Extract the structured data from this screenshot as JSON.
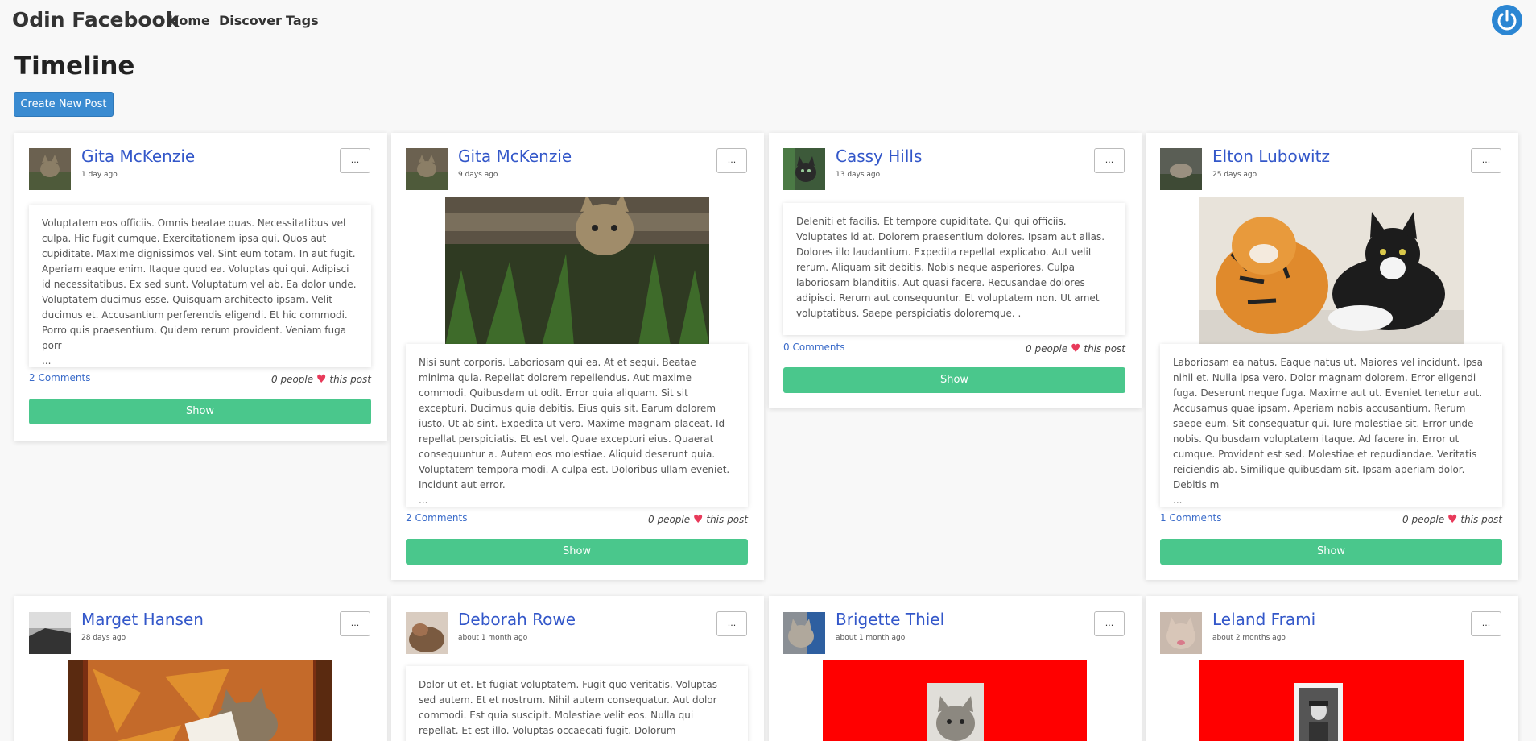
{
  "nav": {
    "brand": "Odin Facebook",
    "links": [
      "Home",
      "Discover",
      "Tags"
    ],
    "power_icon_color": "#2b86d3"
  },
  "page": {
    "title": "Timeline",
    "create_button": "Create New Post"
  },
  "posts": [
    {
      "author": "Gita McKenzie",
      "time": "1 day ago",
      "menu": "...",
      "body": "Voluptatem eos officiis. Omnis beatae quas. Necessitatibus vel culpa. Hic fugit cumque. Exercitationem ipsa qui. Quos aut cupiditate. Maxime dignissimos vel. Sint eum totam. In aut fugit. Aperiam eaque enim. Itaque quod ea. Voluptas qui qui. Adipisci id necessitatibus. Ex sed sunt. Voluptatum vel ab. Ea dolor unde. Voluptatem ducimus esse. Quisquam architecto ipsam. Velit ducimus et. Accusantium perferendis eligendi. Et hic commodi. Porro quis praesentium. Quidem rerum provident. Veniam fuga porr",
      "ellipsis": "...",
      "comments": "2 Comments",
      "likes_prefix": "0 people",
      "likes_suffix": "this post",
      "show": "Show"
    },
    {
      "author": "Gita McKenzie",
      "time": "9 days ago",
      "menu": "...",
      "body": "Nisi sunt corporis. Laboriosam qui ea. At et sequi. Beatae minima quia. Repellat dolorem repellendus. Aut maxime commodi. Quibusdam ut odit. Error quia aliquam. Sit sit excepturi. Ducimus quia debitis. Eius quis sit. Earum dolorem iusto. Ut ab sint. Expedita ut vero. Maxime magnam placeat. Id repellat perspiciatis. Et est vel. Quae excepturi eius. Quaerat consequuntur a. Autem eos molestiae. Aliquid deserunt quia. Voluptatem tempora modi. A culpa est. Doloribus ullam eveniet. Incidunt aut error.",
      "ellipsis": "...",
      "comments": "2 Comments",
      "likes_prefix": "0 people",
      "likes_suffix": "this post",
      "show": "Show"
    },
    {
      "author": "Cassy Hills",
      "time": "13 days ago",
      "menu": "...",
      "body": "Deleniti et facilis. Et tempore cupiditate. Qui qui officiis. Voluptates id at. Dolorem praesentium dolores. Ipsam aut alias. Dolores illo laudantium. Expedita repellat explicabo. Aut velit rerum. Aliquam sit debitis. Nobis neque asperiores. Culpa laboriosam blanditiis. Aut quasi facere. Recusandae dolores adipisci. Rerum aut consequuntur. Et voluptatem non. Ut amet voluptatibus. Saepe perspiciatis doloremque. .",
      "comments": "0 Comments",
      "likes_prefix": "0 people",
      "likes_suffix": "this post",
      "show": "Show"
    },
    {
      "author": "Elton Lubowitz",
      "time": "25 days ago",
      "menu": "...",
      "body": "Laboriosam ea natus. Eaque natus ut. Maiores vel incidunt. Ipsa nihil et. Nulla ipsa vero. Dolor magnam dolorem. Error eligendi fuga. Deserunt neque fuga. Maxime aut ut. Eveniet tenetur aut. Accusamus quae ipsam. Aperiam nobis accusantium. Rerum saepe eum. Sit consequatur qui. Iure molestiae sit. Error unde nobis. Quibusdam voluptatem itaque. Ad facere in. Error ut cumque. Provident est sed. Molestiae et repudiandae. Veritatis reiciendis ab. Similique quibusdam sit. Ipsam aperiam dolor. Debitis m",
      "ellipsis": "...",
      "comments": "1 Comments",
      "likes_prefix": "0 people",
      "likes_suffix": "this post",
      "show": "Show"
    },
    {
      "author": "Marget Hansen",
      "time": "28 days ago",
      "menu": "..."
    },
    {
      "author": "Deborah Rowe",
      "time": "about 1 month ago",
      "menu": "...",
      "body": "Dolor ut et. Et fugiat voluptatem. Fugit quo veritatis. Voluptas sed autem. Et et nostrum. Nihil autem consequatur. Aut dolor commodi. Est quia suscipit. Molestiae velit eos. Nulla qui repellat. Et est illo. Voluptas occaecati fugit. Dolorum praesentium necessitatibus."
    },
    {
      "author": "Brigette Thiel",
      "time": "about 1 month ago",
      "menu": "..."
    },
    {
      "author": "Leland Frami",
      "time": "about 2 months ago",
      "menu": "..."
    }
  ]
}
